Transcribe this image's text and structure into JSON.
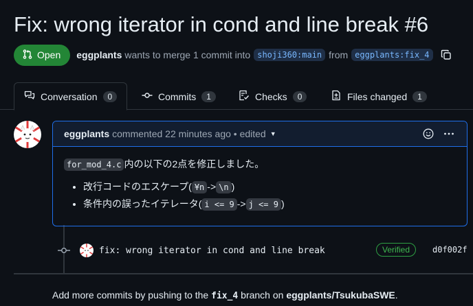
{
  "pr": {
    "title": "Fix: wrong iterator in cond and line break #6",
    "state": "Open",
    "author": "eggplants",
    "summary_pre": "wants to merge 1 commit into",
    "base_branch": "shoji360:main",
    "from": "from",
    "head_branch": "eggplants:fix_4"
  },
  "tabs": [
    {
      "label": "Conversation",
      "count": "0"
    },
    {
      "label": "Commits",
      "count": "1"
    },
    {
      "label": "Checks",
      "count": "0"
    },
    {
      "label": "Files changed",
      "count": "1"
    }
  ],
  "comment": {
    "author": "eggplants",
    "action": "commented 22 minutes ago • edited",
    "file_code": "for_mod_4.c",
    "intro": "内の以下の2点を修正しました。",
    "item1_pre": "改行コードのエスケープ(",
    "item1_code_a": "¥n",
    "item1_arrow": "->",
    "item1_code_b": "\\n",
    "item1_post": ")",
    "item2_pre": "条件内の誤ったイテレータ(",
    "item2_code_a": "i <= 9",
    "item2_arrow": "->",
    "item2_code_b": "j <= 9",
    "item2_post": ")"
  },
  "commit": {
    "message": "fix: wrong iterator in cond and line break",
    "verified": "Verified",
    "sha": "d0f002f"
  },
  "footer": {
    "pre": "Add more commits by pushing to the",
    "branch": "fix_4",
    "mid": "branch on",
    "repo": "eggplants/TsukubaSWE",
    "post": "."
  },
  "colors": {
    "background": "#0d1117",
    "open_green": "#238636",
    "accent_blue": "#1f6feb",
    "verified_green": "#3fb950"
  },
  "icons": [
    "pull-request-icon",
    "copy-icon",
    "conversation-icon",
    "commit-icon",
    "checks-icon",
    "file-diff-icon",
    "smiley-icon",
    "kebab-icon",
    "chevron-down-icon"
  ]
}
